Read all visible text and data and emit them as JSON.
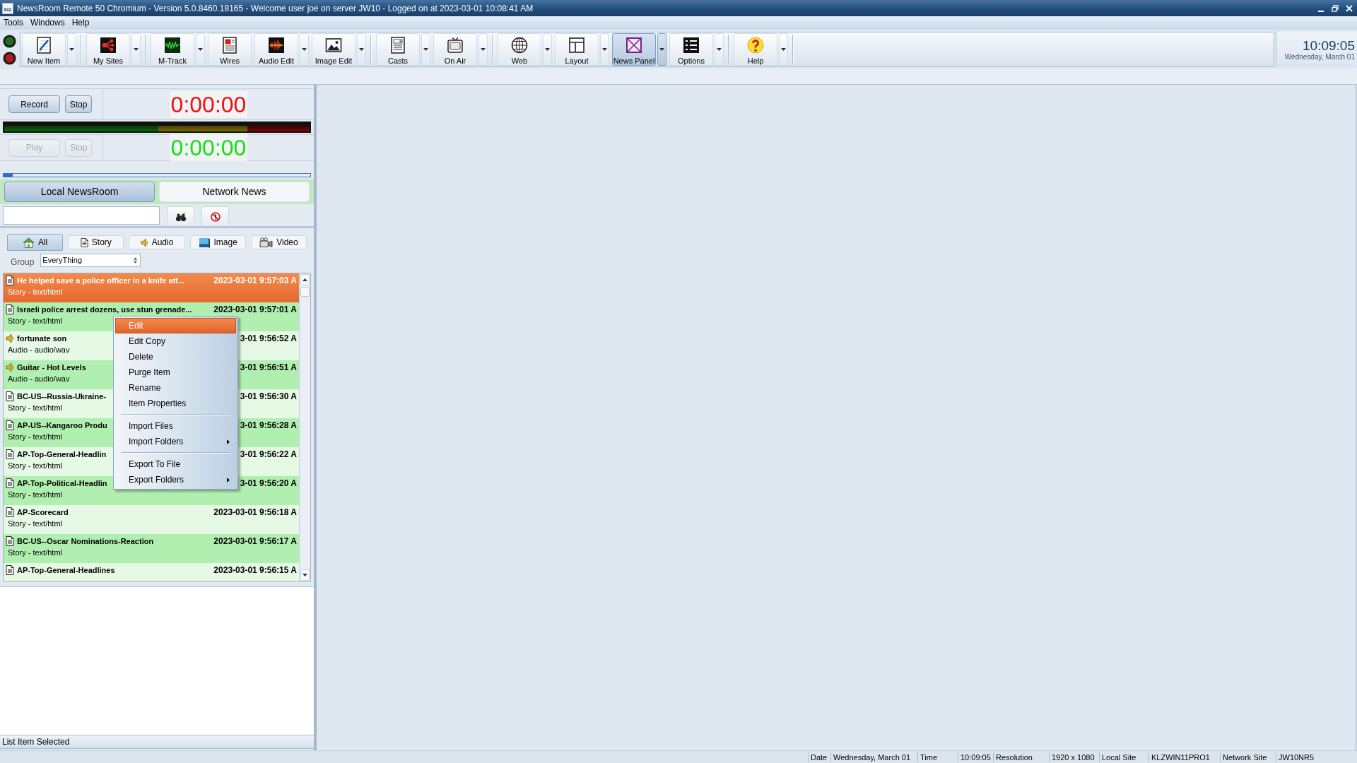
{
  "window": {
    "icon_text": "klz",
    "title": "NewsRoom Remote 50 Chromium - Version 5.0.8460.18165 - Welcome user joe on server JW10 - Logged on at 2023-03-01 10:08:41 AM"
  },
  "menu_bar": [
    "Tools",
    "Windows",
    "Help"
  ],
  "status_lights": [
    {
      "color": "#1c6e22"
    },
    {
      "color": "#b3191b"
    }
  ],
  "toolbar": {
    "groups": [
      [
        {
          "kind": "new",
          "label": "New Item",
          "dropdown": true,
          "selected": false
        }
      ],
      [
        {
          "kind": "sites",
          "label": "My Sites",
          "dropdown": true,
          "selected": false
        }
      ],
      [
        {
          "kind": "track",
          "label": "M-Track",
          "dropdown": true,
          "selected": false
        },
        {
          "kind": "wires",
          "label": "Wires",
          "dropdown": false,
          "selected": false
        },
        {
          "kind": "audio",
          "label": "Audio Edit",
          "dropdown": true,
          "selected": false
        },
        {
          "kind": "image",
          "label": "Image Edit",
          "dropdown": true,
          "selected": false
        }
      ],
      [
        {
          "kind": "casts",
          "label": "Casts",
          "dropdown": true,
          "selected": false
        },
        {
          "kind": "onair",
          "label": "On Air",
          "dropdown": true,
          "selected": false
        }
      ],
      [
        {
          "kind": "web",
          "label": "Web",
          "dropdown": true,
          "selected": false
        },
        {
          "kind": "layout",
          "label": "Layout",
          "dropdown": true,
          "selected": false
        },
        {
          "kind": "panel",
          "label": "News Panel",
          "dropdown": true,
          "selected": true
        },
        {
          "kind": "options",
          "label": "Options",
          "dropdown": true,
          "selected": false
        }
      ],
      [
        {
          "kind": "help",
          "label": "Help",
          "dropdown": true,
          "selected": false
        }
      ]
    ]
  },
  "clock": {
    "time": "10:09:05",
    "date": "Wednesday, March 01"
  },
  "recorder": {
    "record": {
      "buttons": [
        {
          "label": "Record",
          "disabled": false
        },
        {
          "label": "Stop",
          "disabled": false
        }
      ],
      "timer": "0:00:00"
    },
    "play": {
      "buttons": [
        {
          "label": "Play",
          "disabled": true
        },
        {
          "label": "Stop",
          "disabled": true
        }
      ],
      "timer": "0:00:00"
    },
    "position": {
      "level": 0.03
    }
  },
  "source_tabs": [
    {
      "label": "Local NewsRoom",
      "selected": true
    },
    {
      "label": "Network News",
      "selected": false
    }
  ],
  "filter_tabs": [
    {
      "kind": "all",
      "label": "All",
      "selected": true
    },
    {
      "kind": "story",
      "label": "Story",
      "selected": false
    },
    {
      "kind": "audio",
      "label": "Audio",
      "selected": false
    },
    {
      "kind": "image",
      "label": "Image",
      "selected": false
    },
    {
      "kind": "video",
      "label": "Video",
      "selected": false
    }
  ],
  "group": {
    "label": "Group",
    "value": "EveryThing"
  },
  "list": {
    "rows": [
      {
        "kind": "story",
        "title": "He helped save a police officer in a knife att...",
        "date": "2023-03-01 9:57:03 A",
        "type": "Story - text/html",
        "selected": true
      },
      {
        "kind": "story",
        "title": "Israeli police arrest dozens, use stun grenade...",
        "date": "2023-03-01 9:57:01 A",
        "type": "Story - text/html",
        "selected": false
      },
      {
        "kind": "audio",
        "title": "fortunate son",
        "date": "3-01 9:56:52 A",
        "type": "Audio - audio/wav",
        "selected": false
      },
      {
        "kind": "audio",
        "title": "Guitar - Hot Levels",
        "date": "3-01 9:56:51 A",
        "type": "Audio - audio/wav",
        "selected": false
      },
      {
        "kind": "story",
        "title": "BC-US--Russia-Ukraine-",
        "date": "3-01 9:56:30 A",
        "type": "Story - text/html",
        "selected": false
      },
      {
        "kind": "story",
        "title": "AP-US--Kangaroo Produ",
        "date": "3-01 9:56:28 A",
        "type": "Story - text/html",
        "selected": false
      },
      {
        "kind": "story",
        "title": "AP-Top-General-Headlin",
        "date": "3-01 9:56:22 A",
        "type": "Story - text/html",
        "selected": false
      },
      {
        "kind": "story",
        "title": "AP-Top-Political-Headlin",
        "date": "3-01 9:56:20 A",
        "type": "Story - text/html",
        "selected": false
      },
      {
        "kind": "story",
        "title": "AP-Scorecard",
        "date": "2023-03-01 9:56:18 A",
        "type": "Story - text/html",
        "selected": false
      },
      {
        "kind": "story",
        "title": "BC-US--Oscar Nominations-Reaction",
        "date": "2023-03-01 9:56:17 A",
        "type": "Story - text/html",
        "selected": false
      },
      {
        "kind": "story",
        "title": "AP-Top-General-Headlines",
        "date": "2023-03-01 9:56:15 A",
        "selected": false
      }
    ]
  },
  "context_menu": {
    "groups": [
      [
        {
          "label": "Edit",
          "selected": true,
          "submenu": false
        },
        {
          "label": "Edit Copy",
          "selected": false,
          "submenu": false
        },
        {
          "label": "Delete",
          "selected": false,
          "submenu": false
        },
        {
          "label": "Purge Item",
          "selected": false,
          "submenu": false
        },
        {
          "label": "Rename",
          "selected": false,
          "submenu": false
        },
        {
          "label": "Item Properties",
          "selected": false,
          "submenu": false
        }
      ],
      [
        {
          "label": "Import Files",
          "selected": false,
          "submenu": false
        },
        {
          "label": "Import Folders",
          "selected": false,
          "submenu": true
        }
      ],
      [
        {
          "label": "Export To File",
          "selected": false,
          "submenu": false
        },
        {
          "label": "Export Folders",
          "selected": false,
          "submenu": true
        }
      ]
    ]
  },
  "panel_status": "List Item Selected",
  "status_bar": [
    {
      "label": "Date",
      "value": "Wednesday, March 01"
    },
    {
      "label": "Time",
      "value": "10:09:05"
    },
    {
      "label": "Resolution",
      "value": "1920 x 1080"
    },
    {
      "label": "Local Site",
      "value": "KLZWIN11PRO1"
    },
    {
      "label": "Network Site",
      "value": "JW10NR5"
    }
  ]
}
